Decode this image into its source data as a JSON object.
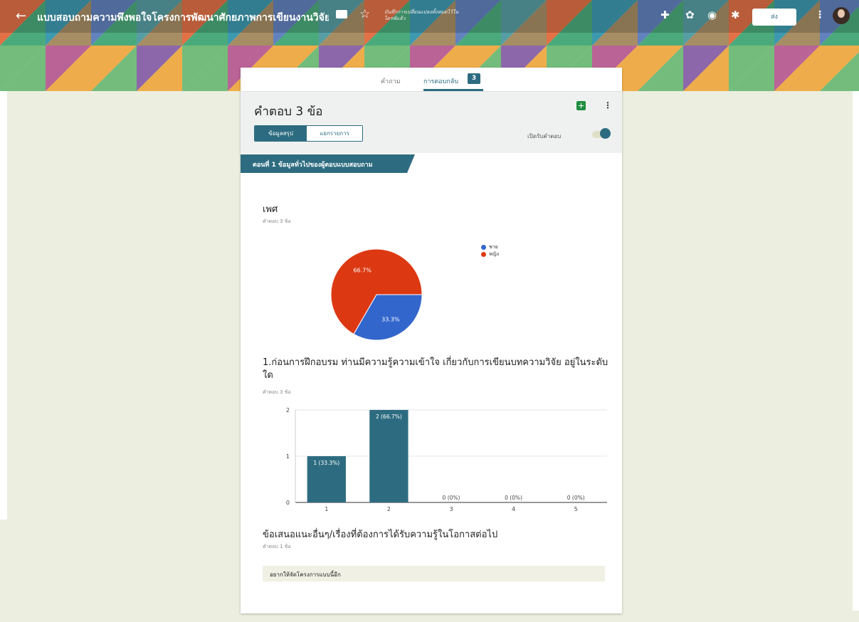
{
  "topbar": {
    "back_icon": "←",
    "title": "แบบสอบถามความพึงพอใจโครงการพัฒนาศักยภาพการเขียนงานวิจัย/งาน",
    "star_icon": "☆",
    "saved_text": "บันทึกการเปลี่ยนแปลงทั้งหมดไว้ในไดรฟ์แล้ว",
    "addons_icon": "✚",
    "palette_icon": "✿",
    "preview_icon": "◉",
    "settings_icon": "✱",
    "send_label": "ส่ง",
    "more_icon": "⋮"
  },
  "tabs": {
    "questions_label": "คำถาม",
    "responses_label": "การตอบกลับ",
    "responses_count": "3"
  },
  "header": {
    "response_count_text": "คำตอบ 3 ข้อ",
    "summary_label": "ข้อมูลสรุป",
    "individual_label": "แยกรายการ",
    "accepting_label": "เปิดรับคำตอบ",
    "more_icon": "⋮"
  },
  "section": {
    "title": "ตอนที่ 1 ข้อมูลทั่วไปของผู้ตอบแบบสอบถาม"
  },
  "questions": [
    {
      "title": "เพศ",
      "subtitle": "คำตอบ 3 ข้อ"
    },
    {
      "title": "1.ก่อนการฝึกอบรม ท่านมีความรู้ความเข้าใจ เกี่ยวกับการเขียนบทความวิจัย อยู่ในระดับใด",
      "subtitle": "คำตอบ 3 ข้อ"
    },
    {
      "title": "ข้อเสนอแนะอื่นๆ/เรื่องที่ต้องการได้รับความรู้ในโอกาสต่อไป",
      "subtitle": "คำตอบ 1 ข้อ",
      "answer": "อยากให้จัดโครงการแบบนี้อีก"
    }
  ],
  "colors": {
    "accent": "#2d6c80",
    "male": "#3366cc",
    "female": "#dc3912",
    "background": "#eceedf"
  },
  "chart_data": [
    {
      "type": "pie",
      "categories": [
        "ชาย",
        "หญิง"
      ],
      "values": [
        1,
        2
      ],
      "labels": [
        "33.3%",
        "66.7%"
      ],
      "colors": [
        "#3366cc",
        "#dc3912"
      ],
      "legend": "right"
    },
    {
      "type": "bar",
      "categories": [
        "1",
        "2",
        "3",
        "4",
        "5"
      ],
      "values": [
        1,
        2,
        0,
        0,
        0
      ],
      "labels": [
        "1 (33.3%)",
        "2 (66.7%)",
        "0 (0%)",
        "0 (0%)",
        "0 (0%)"
      ],
      "yticks": [
        "0",
        "1",
        "2"
      ],
      "ylim": [
        0,
        2
      ],
      "color": "#2d6c80",
      "grid": true
    }
  ]
}
